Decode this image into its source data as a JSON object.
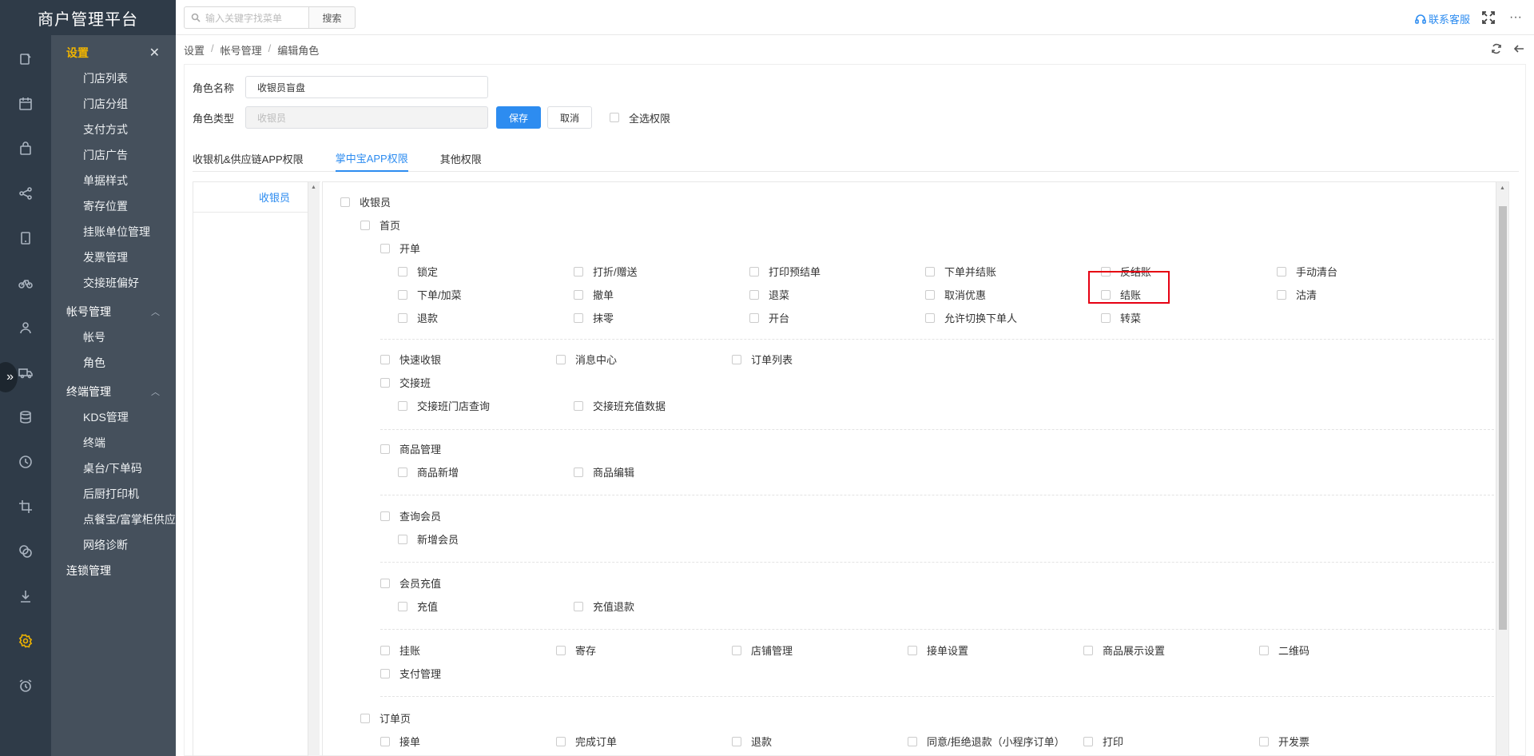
{
  "app": {
    "title": "商户管理平台"
  },
  "topbar": {
    "search_placeholder": "输入关键字找菜单",
    "search_button": "搜索",
    "contact": "联系客服"
  },
  "rail": [
    "document-icon",
    "calendar-icon",
    "bag-icon",
    "share-icon",
    "tablet-icon",
    "bike-icon",
    "user-icon",
    "truck-icon",
    "database-icon",
    "clock-icon",
    "crop-icon",
    "layers-icon",
    "download-icon",
    "gear-icon",
    "alarm-icon"
  ],
  "sidebar": {
    "group_settings": "设置",
    "settings_items": [
      "门店列表",
      "门店分组",
      "支付方式",
      "门店广告",
      "单据样式",
      "寄存位置",
      "挂账单位管理",
      "发票管理",
      "交接班偏好"
    ],
    "group_account": "帐号管理",
    "account_items": [
      "帐号",
      "角色"
    ],
    "group_terminal": "终端管理",
    "terminal_items": [
      "KDS管理",
      "终端",
      "桌台/下单码",
      "后厨打印机",
      "点餐宝/富掌柜供应",
      "网络诊断"
    ],
    "group_chain": "连锁管理"
  },
  "breadcrumb": [
    "设置",
    "帐号管理",
    "编辑角色"
  ],
  "form": {
    "role_name_label": "角色名称",
    "role_name_value": "收银员盲盘",
    "role_type_label": "角色类型",
    "role_type_value": "收银员",
    "save": "保存",
    "cancel": "取消",
    "select_all": "全选权限"
  },
  "tabs": [
    "收银机&供应链APP权限",
    "掌中宝APP权限",
    "其他权限"
  ],
  "roles": [
    "收银员"
  ],
  "permissions": {
    "root": "收银员",
    "home": "首页",
    "open_order": "开单",
    "open_order_items": [
      [
        "锁定",
        "打折/赠送",
        "打印预结单",
        "下单并结账",
        "反结账",
        "手动清台"
      ],
      [
        "下单/加菜",
        "撤单",
        "退菜",
        "取消优惠",
        "结账",
        "沽清"
      ],
      [
        "退款",
        "抹零",
        "开台",
        "允许切换下单人",
        "转菜"
      ]
    ],
    "row_quick": [
      "快速收银",
      "消息中心",
      "订单列表"
    ],
    "shift": "交接班",
    "shift_items": [
      "交接班门店查询",
      "交接班充值数据"
    ],
    "goods": "商品管理",
    "goods_items": [
      "商品新增",
      "商品编辑"
    ],
    "member": "查询会员",
    "member_items": [
      "新增会员"
    ],
    "recharge": "会员充值",
    "recharge_items": [
      "充值",
      "充值退款"
    ],
    "row_misc": [
      "挂账",
      "寄存",
      "店铺管理",
      "接单设置",
      "商品展示设置",
      "二维码"
    ],
    "pay": "支付管理",
    "order_page": "订单页",
    "order_items": [
      "接单",
      "完成订单",
      "退款",
      "同意/拒绝退款（小程序订单）",
      "打印",
      "开发票"
    ]
  }
}
